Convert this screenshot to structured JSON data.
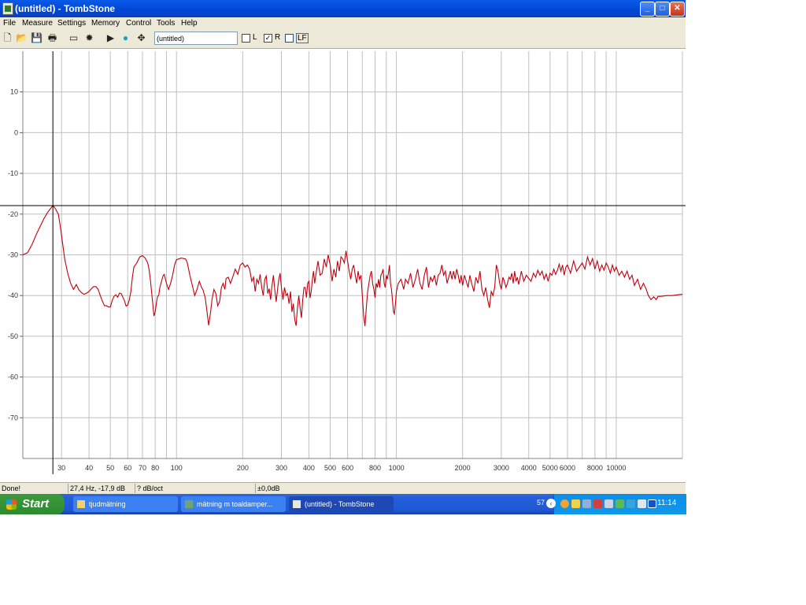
{
  "window": {
    "title": "(untitled) - TombStone",
    "buttons": {
      "minimize": "_",
      "maximize": "□",
      "close": "✕"
    }
  },
  "menu": [
    "File",
    "Measure",
    "Settings",
    "Memory",
    "Control",
    "Tools",
    "Help"
  ],
  "toolbar": {
    "name_value": "(untitled)",
    "checkboxes": [
      {
        "label": "L",
        "checked": false
      },
      {
        "label": "R",
        "checked": true
      },
      {
        "label": "LF",
        "checked": false
      }
    ]
  },
  "plot": {
    "y_ticks": [
      "10",
      "0",
      "-10",
      "-20",
      "-30",
      "-40",
      "-50",
      "-60",
      "-70"
    ],
    "x_ticks": [
      "30",
      "40",
      "50",
      "60",
      "70",
      "80",
      "100",
      "200",
      "300",
      "400",
      "500",
      "600",
      "800",
      "1000",
      "2000",
      "3000",
      "4000",
      "5000",
      "6000",
      "8000",
      "10000"
    ],
    "cursor": {
      "freq_hz": 27.4,
      "db": -17.9
    },
    "curve_color": "#c0000e",
    "grid_color": "#c0c0c0",
    "curve": [
      [
        20,
        -30
      ],
      [
        21,
        -29.5
      ],
      [
        22,
        -27.5
      ],
      [
        23,
        -25
      ],
      [
        24,
        -23
      ],
      [
        25,
        -21
      ],
      [
        26,
        -19.5
      ],
      [
        27.4,
        -17.9
      ],
      [
        28,
        -18.5
      ],
      [
        29,
        -20
      ],
      [
        29.6,
        -23
      ],
      [
        30.3,
        -27
      ],
      [
        31,
        -31
      ],
      [
        32,
        -34.5
      ],
      [
        33,
        -37
      ],
      [
        34,
        -38.5
      ],
      [
        35,
        -37.3
      ],
      [
        36,
        -38.6
      ],
      [
        37,
        -39.3
      ],
      [
        38,
        -39.7
      ],
      [
        39,
        -39.4
      ],
      [
        40,
        -39.0
      ],
      [
        41,
        -38.3
      ],
      [
        42,
        -37.8
      ],
      [
        43,
        -37.8
      ],
      [
        44,
        -38.5
      ],
      [
        45,
        -40
      ],
      [
        46,
        -41.3
      ],
      [
        47,
        -42.5
      ],
      [
        48,
        -42.5
      ],
      [
        49,
        -42.8
      ],
      [
        50,
        -42.8
      ],
      [
        51,
        -41.2
      ],
      [
        52,
        -40.2
      ],
      [
        53,
        -39.8
      ],
      [
        54,
        -40.4
      ],
      [
        55,
        -39.4
      ],
      [
        56,
        -39.5
      ],
      [
        57,
        -40.4
      ],
      [
        58,
        -41.3
      ],
      [
        59,
        -42.6
      ],
      [
        60,
        -42.3
      ],
      [
        61,
        -41
      ],
      [
        62,
        -39
      ],
      [
        63,
        -35.5
      ],
      [
        64,
        -33
      ],
      [
        66,
        -32
      ],
      [
        68,
        -30.5
      ],
      [
        70,
        -30.2
      ],
      [
        72,
        -30.8
      ],
      [
        74,
        -32
      ],
      [
        75,
        -33.5
      ],
      [
        76,
        -36
      ],
      [
        77,
        -39
      ],
      [
        78,
        -42
      ],
      [
        79,
        -45
      ],
      [
        80,
        -44
      ],
      [
        81,
        -41.8
      ],
      [
        82,
        -40.2
      ],
      [
        83,
        -40
      ],
      [
        84,
        -38
      ],
      [
        86,
        -36
      ],
      [
        87,
        -35
      ],
      [
        88,
        -34.8
      ],
      [
        90,
        -37
      ],
      [
        92,
        -38.5
      ],
      [
        94,
        -37
      ],
      [
        96,
        -35
      ],
      [
        98,
        -32.5
      ],
      [
        100,
        -31.2
      ],
      [
        105,
        -30.8
      ],
      [
        110,
        -31
      ],
      [
        112,
        -32
      ],
      [
        115,
        -35
      ],
      [
        118,
        -37.5
      ],
      [
        121,
        -40
      ],
      [
        124,
        -38.5
      ],
      [
        127,
        -36.5
      ],
      [
        130,
        -38
      ],
      [
        132,
        -38.6
      ],
      [
        135,
        -40.5
      ],
      [
        137,
        -43
      ],
      [
        140,
        -47.3
      ],
      [
        143,
        -44
      ],
      [
        145,
        -41
      ],
      [
        148,
        -38.5
      ],
      [
        151,
        -39.5
      ],
      [
        154,
        -42.5
      ],
      [
        157,
        -41.5
      ],
      [
        160,
        -38
      ],
      [
        163,
        -37
      ],
      [
        166,
        -38.5
      ],
      [
        168,
        -35.8
      ],
      [
        172,
        -35.5
      ],
      [
        176,
        -37
      ],
      [
        180,
        -35.5
      ],
      [
        185,
        -33.5
      ],
      [
        190,
        -34.8
      ],
      [
        195,
        -32.5
      ],
      [
        200,
        -32
      ],
      [
        205,
        -33
      ],
      [
        210,
        -32.5
      ],
      [
        215,
        -33.5
      ],
      [
        220,
        -36.5
      ],
      [
        224,
        -35.5
      ],
      [
        228,
        -39
      ],
      [
        232,
        -36
      ],
      [
        236,
        -37
      ],
      [
        240,
        -34.8
      ],
      [
        244,
        -38
      ],
      [
        248,
        -40
      ],
      [
        252,
        -36
      ],
      [
        256,
        -35.2
      ],
      [
        260,
        -39.5
      ],
      [
        264,
        -38.3
      ],
      [
        268,
        -41
      ],
      [
        272,
        -37.5
      ],
      [
        276,
        -35
      ],
      [
        280,
        -38.8
      ],
      [
        284,
        -41.5
      ],
      [
        288,
        -38.5
      ],
      [
        292,
        -36
      ],
      [
        296,
        -34.5
      ],
      [
        300,
        -38
      ],
      [
        305,
        -41
      ],
      [
        310,
        -38
      ],
      [
        315,
        -40
      ],
      [
        320,
        -39.5
      ],
      [
        325,
        -42
      ],
      [
        330,
        -39
      ],
      [
        335,
        -44
      ],
      [
        340,
        -42
      ],
      [
        345,
        -46
      ],
      [
        350,
        -47.4
      ],
      [
        355,
        -43
      ],
      [
        360,
        -40
      ],
      [
        365,
        -43
      ],
      [
        370,
        -45.5
      ],
      [
        375,
        -41
      ],
      [
        380,
        -38
      ],
      [
        385,
        -38
      ],
      [
        390,
        -40.5
      ],
      [
        395,
        -37
      ],
      [
        400,
        -36.5
      ],
      [
        405,
        -40.6
      ],
      [
        410,
        -39
      ],
      [
        415,
        -36
      ],
      [
        420,
        -34
      ],
      [
        425,
        -37
      ],
      [
        430,
        -35
      ],
      [
        440,
        -31.5
      ],
      [
        450,
        -35
      ],
      [
        460,
        -34.5
      ],
      [
        470,
        -31
      ],
      [
        480,
        -33
      ],
      [
        490,
        -30
      ],
      [
        500,
        -32.5
      ],
      [
        510,
        -36.5
      ],
      [
        520,
        -33.5
      ],
      [
        530,
        -35.5
      ],
      [
        540,
        -31.5
      ],
      [
        550,
        -34
      ],
      [
        560,
        -30.5
      ],
      [
        570,
        -31
      ],
      [
        580,
        -32
      ],
      [
        590,
        -29
      ],
      [
        600,
        -31.5
      ],
      [
        610,
        -34
      ],
      [
        620,
        -36
      ],
      [
        630,
        -33.5
      ],
      [
        640,
        -32.5
      ],
      [
        650,
        -35
      ],
      [
        660,
        -37
      ],
      [
        670,
        -34
      ],
      [
        680,
        -36
      ],
      [
        690,
        -35
      ],
      [
        700,
        -40
      ],
      [
        710,
        -45
      ],
      [
        720,
        -47.5
      ],
      [
        730,
        -43
      ],
      [
        740,
        -39
      ],
      [
        750,
        -37
      ],
      [
        760,
        -35
      ],
      [
        770,
        -34
      ],
      [
        780,
        -37
      ],
      [
        790,
        -38.5
      ],
      [
        800,
        -40.5
      ],
      [
        810,
        -37
      ],
      [
        820,
        -38
      ],
      [
        830,
        -36
      ],
      [
        840,
        -38
      ],
      [
        850,
        -35
      ],
      [
        860,
        -34.5
      ],
      [
        870,
        -33.5
      ],
      [
        880,
        -37
      ],
      [
        890,
        -38
      ],
      [
        900,
        -35
      ],
      [
        910,
        -36
      ],
      [
        920,
        -34.5
      ],
      [
        930,
        -32.5
      ],
      [
        940,
        -37
      ],
      [
        950,
        -38.5
      ],
      [
        960,
        -41
      ],
      [
        970,
        -44
      ],
      [
        980,
        -44.5
      ],
      [
        990,
        -42
      ],
      [
        1000,
        -39
      ],
      [
        1020,
        -37
      ],
      [
        1050,
        -36
      ],
      [
        1080,
        -38.5
      ],
      [
        1100,
        -36
      ],
      [
        1130,
        -37
      ],
      [
        1160,
        -34.5
      ],
      [
        1190,
        -38
      ],
      [
        1220,
        -36
      ],
      [
        1250,
        -33.5
      ],
      [
        1280,
        -37
      ],
      [
        1310,
        -38.5
      ],
      [
        1340,
        -35
      ],
      [
        1370,
        -33
      ],
      [
        1400,
        -38
      ],
      [
        1430,
        -35.5
      ],
      [
        1460,
        -36.5
      ],
      [
        1490,
        -35
      ],
      [
        1520,
        -37.5
      ],
      [
        1550,
        -35
      ],
      [
        1580,
        -34.5
      ],
      [
        1610,
        -32.5
      ],
      [
        1640,
        -35
      ],
      [
        1670,
        -34
      ],
      [
        1700,
        -37
      ],
      [
        1730,
        -35.5
      ],
      [
        1760,
        -34
      ],
      [
        1790,
        -36
      ],
      [
        1820,
        -34
      ],
      [
        1850,
        -36
      ],
      [
        1880,
        -33.5
      ],
      [
        1910,
        -35
      ],
      [
        1940,
        -37
      ],
      [
        1970,
        -35
      ],
      [
        2000,
        -37.5
      ],
      [
        2040,
        -35
      ],
      [
        2080,
        -36.5
      ],
      [
        2120,
        -38
      ],
      [
        2160,
        -35
      ],
      [
        2200,
        -37
      ],
      [
        2250,
        -39
      ],
      [
        2300,
        -35.5
      ],
      [
        2350,
        -37
      ],
      [
        2400,
        -34
      ],
      [
        2450,
        -38.5
      ],
      [
        2500,
        -40
      ],
      [
        2550,
        -38
      ],
      [
        2600,
        -41
      ],
      [
        2650,
        -43
      ],
      [
        2700,
        -39
      ],
      [
        2750,
        -40
      ],
      [
        2800,
        -38
      ],
      [
        2850,
        -32.5
      ],
      [
        2900,
        -34
      ],
      [
        2950,
        -37
      ],
      [
        3000,
        -38.5
      ],
      [
        3050,
        -35.5
      ],
      [
        3100,
        -36.5
      ],
      [
        3150,
        -38
      ],
      [
        3200,
        -37
      ],
      [
        3250,
        -35.5
      ],
      [
        3300,
        -36
      ],
      [
        3350,
        -34.5
      ],
      [
        3400,
        -37
      ],
      [
        3450,
        -34
      ],
      [
        3500,
        -36.5
      ],
      [
        3550,
        -35.5
      ],
      [
        3600,
        -37.3
      ],
      [
        3700,
        -34
      ],
      [
        3800,
        -36.5
      ],
      [
        3900,
        -35
      ],
      [
        4000,
        -35.8
      ],
      [
        4100,
        -36.5
      ],
      [
        4200,
        -34.5
      ],
      [
        4300,
        -35.5
      ],
      [
        4400,
        -33.8
      ],
      [
        4500,
        -35
      ],
      [
        4600,
        -34
      ],
      [
        4700,
        -36
      ],
      [
        4800,
        -34.7
      ],
      [
        4900,
        -36.5
      ],
      [
        5000,
        -34.5
      ],
      [
        5100,
        -35
      ],
      [
        5200,
        -33.5
      ],
      [
        5300,
        -34.8
      ],
      [
        5400,
        -33.8
      ],
      [
        5500,
        -32.3
      ],
      [
        5600,
        -34
      ],
      [
        5700,
        -32.5
      ],
      [
        5800,
        -35
      ],
      [
        5900,
        -33
      ],
      [
        6000,
        -32.5
      ],
      [
        6200,
        -34.5
      ],
      [
        6400,
        -31.5
      ],
      [
        6600,
        -34
      ],
      [
        6800,
        -33
      ],
      [
        7000,
        -32
      ],
      [
        7200,
        -33.5
      ],
      [
        7400,
        -30.5
      ],
      [
        7600,
        -32.5
      ],
      [
        7800,
        -30.9
      ],
      [
        8000,
        -33.5
      ],
      [
        8200,
        -31.5
      ],
      [
        8400,
        -34
      ],
      [
        8600,
        -32.5
      ],
      [
        8800,
        -33.8
      ],
      [
        9000,
        -32
      ],
      [
        9200,
        -33
      ],
      [
        9400,
        -34.5
      ],
      [
        9600,
        -32.5
      ],
      [
        9800,
        -34
      ],
      [
        10000,
        -33
      ],
      [
        10300,
        -35
      ],
      [
        10600,
        -34
      ],
      [
        10900,
        -35.5
      ],
      [
        11200,
        -34
      ],
      [
        11500,
        -36
      ],
      [
        11800,
        -35
      ],
      [
        12100,
        -37.5
      ],
      [
        12500,
        -36
      ],
      [
        12900,
        -38.5
      ],
      [
        13300,
        -37
      ],
      [
        13700,
        -38.5
      ],
      [
        14000,
        -40
      ],
      [
        14400,
        -41
      ],
      [
        14800,
        -40.3
      ],
      [
        15200,
        -41
      ],
      [
        15500,
        -40.2
      ],
      [
        16000,
        -40.2
      ],
      [
        17000,
        -40
      ],
      [
        18000,
        -40
      ],
      [
        19000,
        -39.8
      ],
      [
        20000,
        -39.7
      ]
    ]
  },
  "status": {
    "left": "Done!",
    "cursor": "27,4 Hz, -17,9 dB",
    "smoothing": "? dB/oct",
    "offset": "±0,0dB"
  },
  "taskbar": {
    "start_label": "Start",
    "tasks": [
      {
        "label": "tjudmätning",
        "active": false
      },
      {
        "label": "mätning m toaldamper...",
        "active": false
      },
      {
        "label": "(untitled) - TombStone",
        "active": true
      }
    ],
    "tray_count": "57",
    "clock": "11:14"
  }
}
